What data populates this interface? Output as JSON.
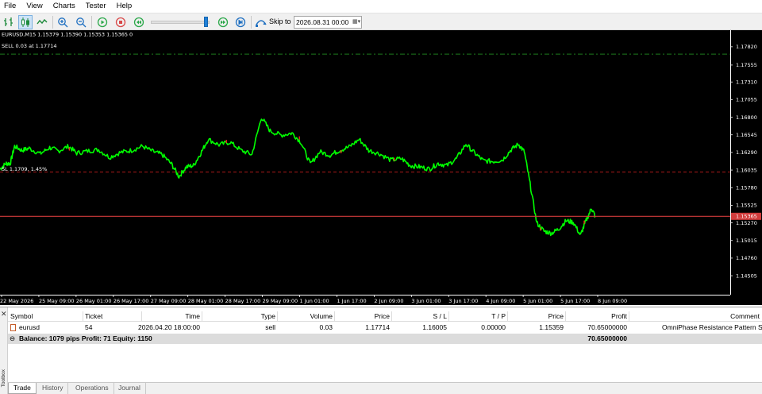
{
  "menu": [
    "File",
    "View",
    "Charts",
    "Tester",
    "Help"
  ],
  "toolbar": {
    "icons": [
      "bar-chart-icon",
      "candlestick-icon",
      "line-chart-icon",
      "zoom-in-icon",
      "zoom-out-icon",
      "play-icon",
      "stop-icon",
      "rewind-icon",
      "forward-icon",
      "step-icon",
      "skip-to-icon"
    ],
    "speed_percent": 93,
    "skip_to_label": "Skip to",
    "skip_to_value": "2026.08.31 00:00"
  },
  "chart": {
    "symbol_info": "EURUSD,M15  1.15379 1.15390 1.15353 1.15365  0",
    "order_label": "SELL 0.03 at 1.17714",
    "sl_label": "SL 1.1709, 1.45%",
    "colors": {
      "background": "#000000",
      "candles": "#00ff00",
      "bearish_marks": "#ff2020",
      "sell_line": "#1e7a1e",
      "sl_line": "#aa1a1a",
      "price_line": "#d03b3b"
    },
    "current_price_label": "1.15365",
    "price_axis": [
      "1.17820",
      "1.17555",
      "1.17310",
      "1.17055",
      "1.16800",
      "1.16545",
      "1.16290",
      "1.16035",
      "1.15780",
      "1.15525",
      "1.15270",
      "1.15015",
      "1.14760",
      "1.14505"
    ],
    "time_axis": [
      "22 May 2026",
      "25 May 09:00",
      "26 May 01:00",
      "26 May 17:00",
      "27 May 09:00",
      "28 May 01:00",
      "28 May 17:00",
      "29 May 09:00",
      "1 Jun 01:00",
      "1 Jun 17:00",
      "2 Jun 09:00",
      "3 Jun 01:00",
      "3 Jun 17:00",
      "4 Jun 09:00",
      "5 Jun 01:00",
      "5 Jun 17:00",
      "8 Jun 09:00"
    ],
    "ylim": [
      1.1423,
      1.1806
    ],
    "price_path": [
      [
        0.0,
        1.1605
      ],
      [
        0.008,
        1.1613
      ],
      [
        0.014,
        1.1613
      ],
      [
        0.02,
        1.1638
      ],
      [
        0.03,
        1.1632
      ],
      [
        0.04,
        1.1635
      ],
      [
        0.055,
        1.1627
      ],
      [
        0.068,
        1.1636
      ],
      [
        0.08,
        1.1631
      ],
      [
        0.094,
        1.1638
      ],
      [
        0.105,
        1.1628
      ],
      [
        0.12,
        1.1631
      ],
      [
        0.135,
        1.1633
      ],
      [
        0.15,
        1.1622
      ],
      [
        0.165,
        1.1629
      ],
      [
        0.18,
        1.1632
      ],
      [
        0.195,
        1.1638
      ],
      [
        0.21,
        1.163
      ],
      [
        0.222,
        1.1626
      ],
      [
        0.235,
        1.1612
      ],
      [
        0.245,
        1.1594
      ],
      [
        0.255,
        1.1608
      ],
      [
        0.265,
        1.161
      ],
      [
        0.275,
        1.1628
      ],
      [
        0.285,
        1.1648
      ],
      [
        0.3,
        1.164
      ],
      [
        0.315,
        1.1644
      ],
      [
        0.33,
        1.1632
      ],
      [
        0.345,
        1.1626
      ],
      [
        0.358,
        1.168
      ],
      [
        0.37,
        1.166
      ],
      [
        0.385,
        1.1654
      ],
      [
        0.4,
        1.1657
      ],
      [
        0.412,
        1.1644
      ],
      [
        0.425,
        1.1612
      ],
      [
        0.438,
        1.163
      ],
      [
        0.452,
        1.1625
      ],
      [
        0.465,
        1.1632
      ],
      [
        0.478,
        1.1637
      ],
      [
        0.492,
        1.1648
      ],
      [
        0.505,
        1.1632
      ],
      [
        0.52,
        1.1627
      ],
      [
        0.535,
        1.1618
      ],
      [
        0.55,
        1.162
      ],
      [
        0.562,
        1.161
      ],
      [
        0.575,
        1.1608
      ],
      [
        0.588,
        1.1605
      ],
      [
        0.6,
        1.1613
      ],
      [
        0.612,
        1.161
      ],
      [
        0.625,
        1.162
      ],
      [
        0.638,
        1.1641
      ],
      [
        0.65,
        1.1628
      ],
      [
        0.662,
        1.1617
      ],
      [
        0.675,
        1.1616
      ],
      [
        0.688,
        1.1618
      ],
      [
        0.7,
        1.1633
      ],
      [
        0.71,
        1.1641
      ],
      [
        0.718,
        1.163
      ],
      [
        0.726,
        1.1583
      ],
      [
        0.735,
        1.1527
      ],
      [
        0.745,
        1.1515
      ],
      [
        0.755,
        1.1512
      ],
      [
        0.765,
        1.1518
      ],
      [
        0.775,
        1.153
      ],
      [
        0.785,
        1.1528
      ],
      [
        0.795,
        1.1509
      ],
      [
        0.802,
        1.1529
      ],
      [
        0.81,
        1.1548
      ],
      [
        0.815,
        1.1537
      ]
    ]
  },
  "terminal": {
    "side_label": "Toolbox",
    "columns": [
      "Symbol",
      "Ticket",
      "Time",
      "Type",
      "Volume",
      "Price",
      "S / L",
      "T / P",
      "Price",
      "Profit",
      "Comment"
    ],
    "rows": [
      {
        "symbol": "eurusd",
        "ticket": "54",
        "time": "2026.04.20 18:00:00",
        "type": "sell",
        "volume": "0.03",
        "price_open": "1.17714",
        "sl": "1.16005",
        "tp": "0.00000",
        "price_current": "1.15359",
        "profit": "70.65000000",
        "comment": "OmniPhase Resistance Pattern Se"
      }
    ],
    "balance_text": "Balance: 1079 pips   Profit: 71   Equity: 1150",
    "balance_profit": "70.65000000",
    "tabs": [
      "Trade",
      "History",
      "Operations",
      "Journal"
    ],
    "active_tab": "Trade"
  }
}
